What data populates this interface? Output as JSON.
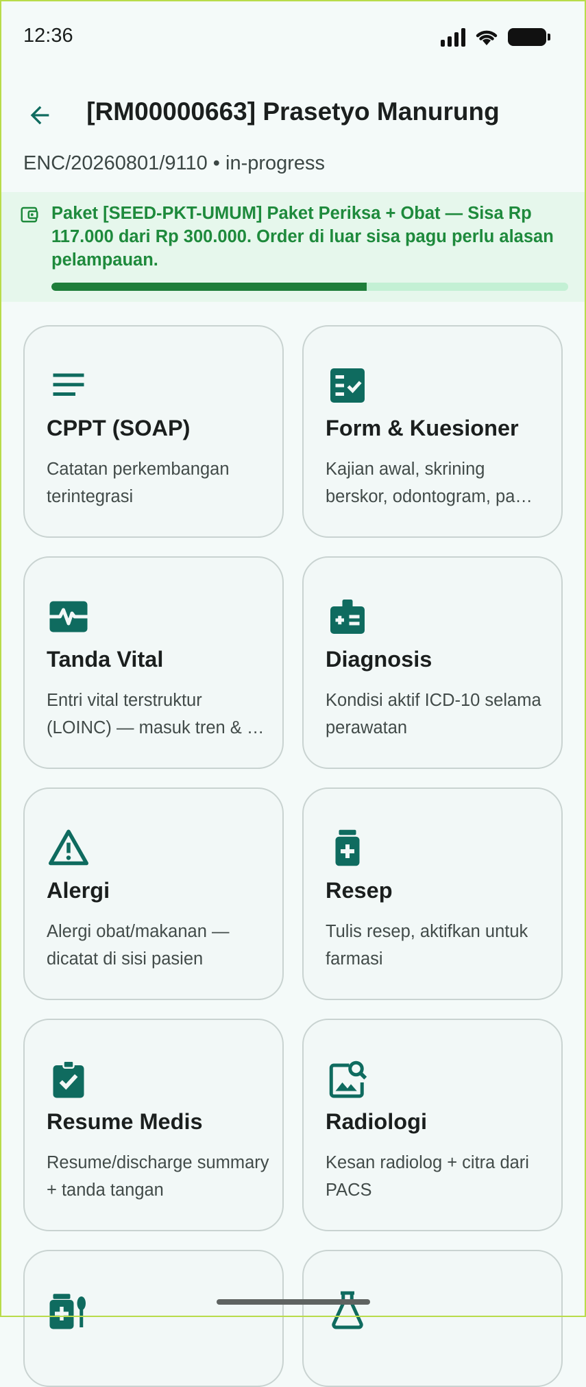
{
  "status_bar": {
    "time": "12:36"
  },
  "header": {
    "title": "[RM00000663] Prasetyo Manurung",
    "subtitle": "ENC/20260801/9110 • in-progress"
  },
  "package_banner": {
    "text": "Paket [SEED-PKT-UMUM] Paket Periksa + Obat — Sisa Rp 117.000 dari Rp 300.000. Order di luar sisa pagu perlu alasan pelampauan.",
    "remaining_fraction": 0.61
  },
  "colors": {
    "accent": "#0F6B5F",
    "banner_text": "#1E8A3C",
    "banner_bg": "#E6F7EC"
  },
  "menu": [
    {
      "title": "CPPT (SOAP)",
      "desc": "Catatan perkembangan terintegrasi",
      "icon": "notes-icon"
    },
    {
      "title": "Form & Kuesioner",
      "desc": "Kajian awal, skrining berskor, odontogram, pa…",
      "icon": "form-checklist-icon"
    },
    {
      "title": "Tanda Vital",
      "desc": "Entri vital terstruktur (LOINC) — masuk tren & …",
      "icon": "vital-signs-icon"
    },
    {
      "title": "Diagnosis",
      "desc": "Kondisi aktif ICD-10 selama perawatan",
      "icon": "diagnosis-icon"
    },
    {
      "title": "Alergi",
      "desc": "Alergi obat/makanan — dicatat di sisi pasien",
      "icon": "warning-icon"
    },
    {
      "title": "Resep",
      "desc": "Tulis resep, aktifkan untuk farmasi",
      "icon": "medication-icon"
    },
    {
      "title": "Resume Medis",
      "desc": "Resume/discharge summary + tanda tangan",
      "icon": "clipboard-check-icon"
    },
    {
      "title": "Radiologi",
      "desc": "Kesan radiolog + citra dari PACS",
      "icon": "image-search-icon"
    }
  ]
}
